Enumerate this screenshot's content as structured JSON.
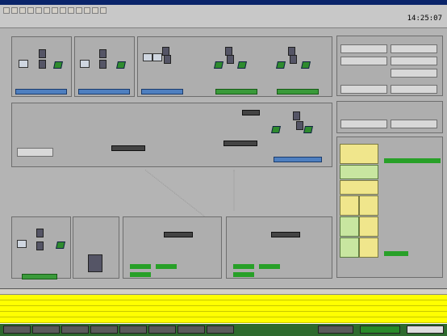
{
  "window": {
    "title": ""
  },
  "clock": "14:25:07",
  "alarms": {
    "rows": [
      {},
      {},
      {},
      {},
      {}
    ]
  }
}
